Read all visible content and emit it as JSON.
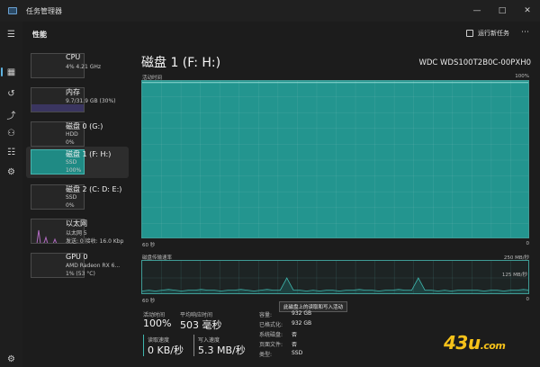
{
  "window": {
    "title": "任务管理器",
    "controls": [
      "—",
      "□",
      "✕"
    ]
  },
  "header": {
    "section_title": "性能",
    "run_new_task": "运行新任务",
    "more": "⋯"
  },
  "sidebar": {
    "icons": [
      "menu-icon",
      "performance-icon",
      "history-icon",
      "startup-icon",
      "users-icon",
      "details-icon",
      "services-icon",
      "settings-icon"
    ],
    "glyphs": [
      "☰",
      "▦",
      "↺",
      "⤴",
      "⚇",
      "☷",
      "⚙",
      "⚙"
    ]
  },
  "devices": [
    {
      "name": "CPU",
      "sub1": "4% 4.21 GHz",
      "sub2": ""
    },
    {
      "name": "内存",
      "sub1": "9.7/31.9 GB (30%)",
      "sub2": ""
    },
    {
      "name": "磁盘 0 (G:)",
      "sub1": "HDD",
      "sub2": "0%"
    },
    {
      "name": "磁盘 1 (F: H:)",
      "sub1": "SSD",
      "sub2": "100%"
    },
    {
      "name": "磁盘 2 (C: D: E:)",
      "sub1": "SSD",
      "sub2": "0%"
    },
    {
      "name": "以太网",
      "sub1": "以太网 5",
      "sub2": "发送: 0 接收: 16.0 Kbp"
    },
    {
      "name": "GPU 0",
      "sub1": "AMD Radeon RX 6...",
      "sub2": "1% (53 °C)"
    }
  ],
  "detail": {
    "title": "磁盘 1 (F: H:)",
    "model": "WDC WDS100T2B0C-00PXH0",
    "active_time_label": "活动时间",
    "active_time_max": "100%",
    "active_time_left": "60 秒",
    "active_time_right": "0",
    "transfer_label": "磁盘传输速率",
    "transfer_max": "250 MB/秒",
    "transfer_mid": "125 MB/秒",
    "transfer_left": "60 秒",
    "transfer_right": "0",
    "tooltip": "此磁盘上的读取和写入活动"
  },
  "stats": {
    "active_time_label": "活动时间",
    "active_time_value": "100%",
    "avg_response_label": "平均响应时间",
    "avg_response_value": "503 毫秒",
    "read_label": "读取速度",
    "read_value": "0 KB/秒",
    "write_label": "写入速度",
    "write_value": "5.3 MB/秒"
  },
  "properties": [
    {
      "key": "容量:",
      "value": "932 GB"
    },
    {
      "key": "已格式化:",
      "value": "932 GB"
    },
    {
      "key": "系统磁盘:",
      "value": "否"
    },
    {
      "key": "页面文件:",
      "value": "否"
    },
    {
      "key": "类型:",
      "value": "SSD"
    }
  ],
  "watermark": {
    "main": "43u",
    "suffix": ".com"
  },
  "colors": {
    "accent": "#23958f",
    "read_accent": "#3fb6ad",
    "write_accent": "#8a8a8a"
  },
  "chart_data": {
    "type": "line",
    "activity_percent": [
      99,
      99,
      99,
      99,
      99,
      99,
      99,
      99,
      99,
      99,
      99,
      99,
      99,
      99,
      99,
      99,
      99,
      99,
      99,
      99,
      99,
      99,
      99,
      99,
      99,
      99,
      99,
      99,
      99,
      99
    ],
    "transfer_mb_s": [
      3,
      4,
      3,
      4,
      5,
      4,
      3,
      4,
      4,
      5,
      4,
      4,
      3,
      4,
      4,
      5,
      4,
      3,
      4,
      5,
      4,
      4,
      3,
      4,
      4,
      3,
      4,
      3,
      4,
      4,
      3,
      4,
      4,
      5,
      4,
      4,
      3,
      4,
      4,
      5,
      4,
      4,
      3,
      4,
      4,
      3,
      4,
      3,
      4,
      4,
      4,
      4,
      3,
      4,
      4,
      3,
      4,
      4,
      5,
      4
    ],
    "transfer_spikes": [
      [
        21.5,
        20
      ],
      [
        42,
        20
      ]
    ],
    "ylim_activity": [
      0,
      100
    ],
    "ylim_transfer": [
      0,
      250
    ]
  }
}
